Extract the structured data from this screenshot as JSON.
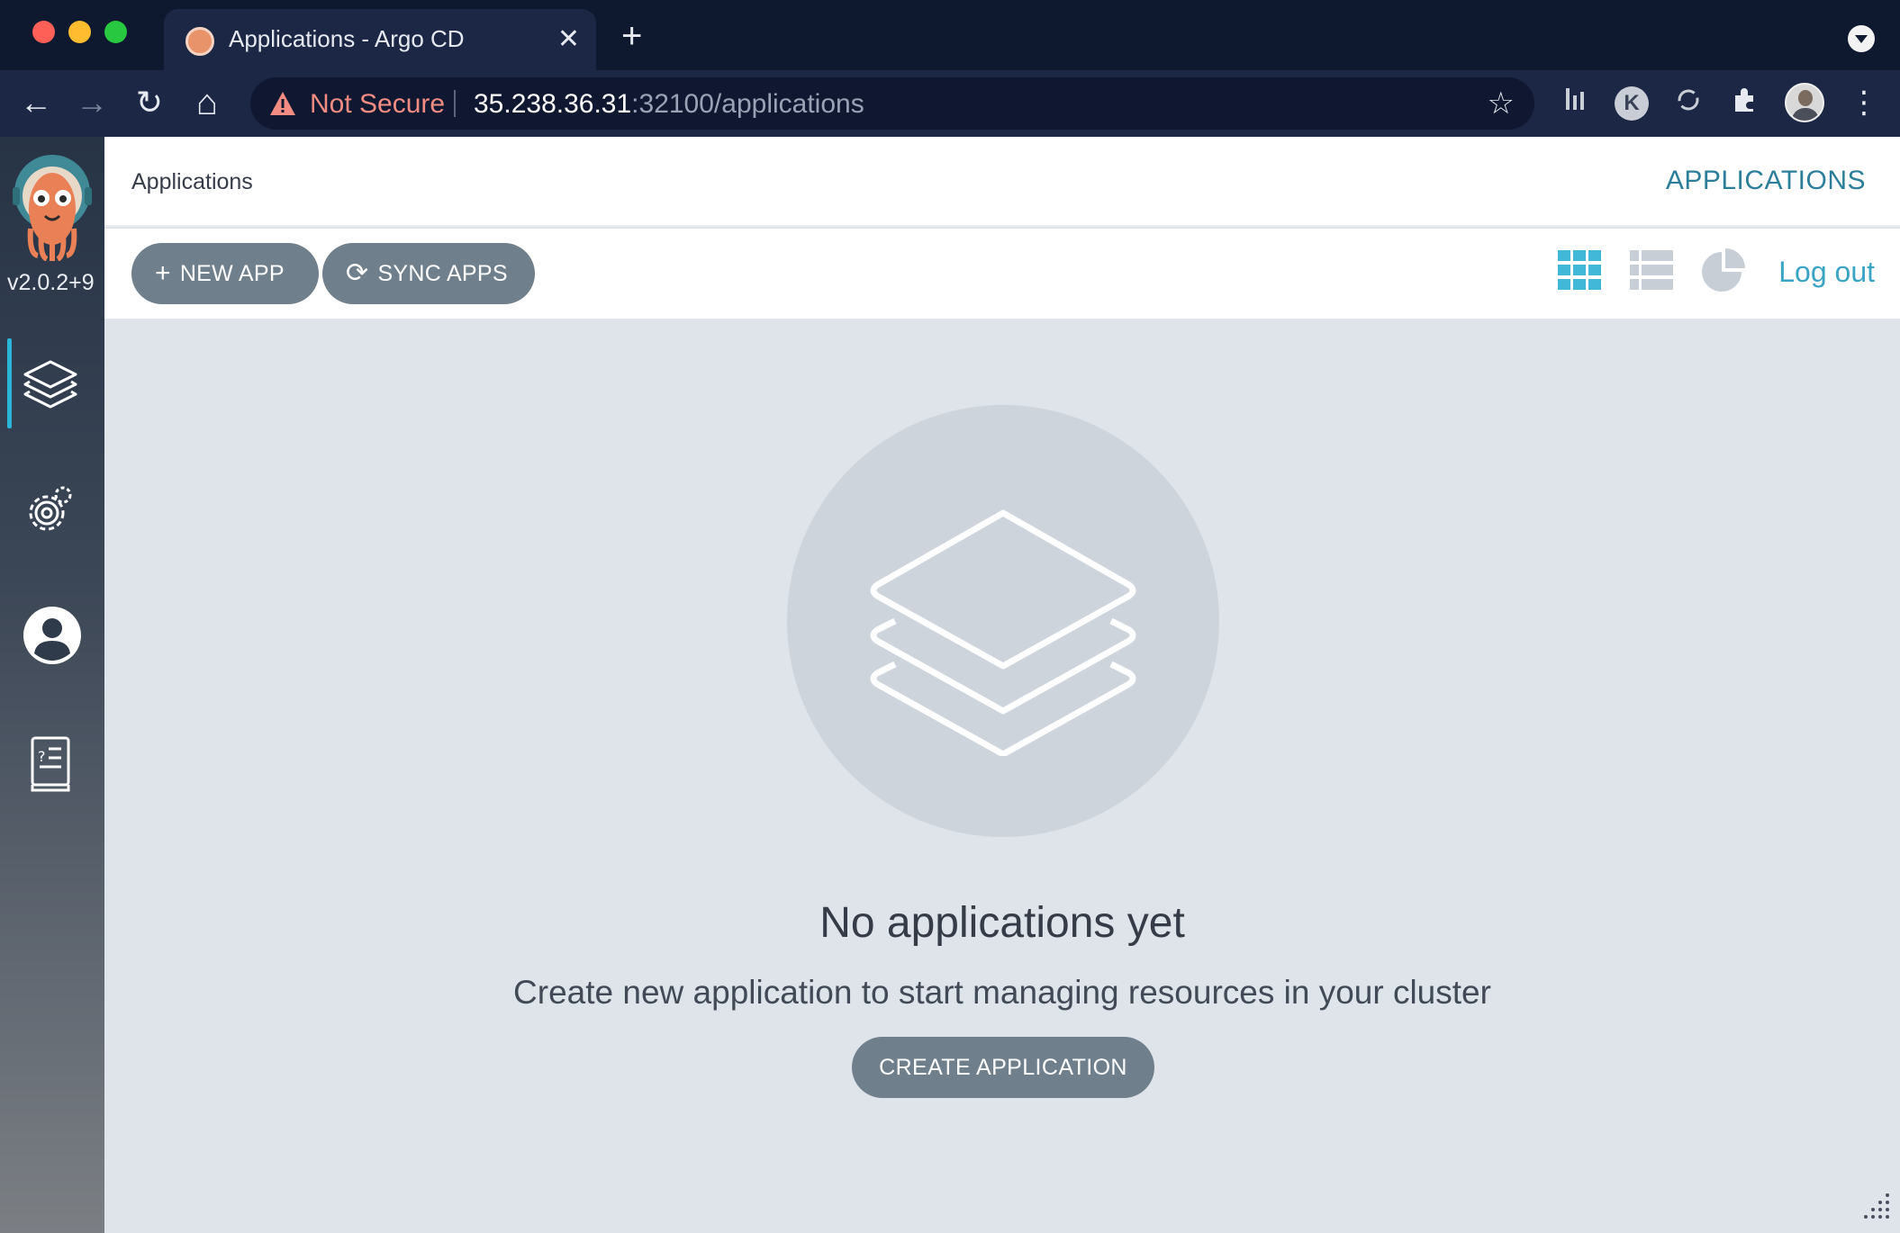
{
  "browser": {
    "tab_title": "Applications - Argo CD",
    "close_glyph": "✕",
    "new_tab_glyph": "+",
    "security_label": "Not Secure",
    "url_host": "35.238.36.31",
    "url_rest": ":32100/applications",
    "nav": {
      "back": "←",
      "forward": "→",
      "reload": "↻",
      "home": "⌂"
    },
    "bookmark_glyph": "☆",
    "extension_k": "K",
    "menu_glyph": "⋮"
  },
  "sidebar": {
    "version": "v2.0.2+9",
    "items": [
      {
        "name": "applications",
        "icon": "layers-icon",
        "active": true
      },
      {
        "name": "settings",
        "icon": "gear-icon",
        "active": false
      },
      {
        "name": "user-info",
        "icon": "user-circle-icon",
        "active": false
      },
      {
        "name": "documentation",
        "icon": "book-icon",
        "active": false
      }
    ]
  },
  "header": {
    "breadcrumb": "Applications",
    "title": "APPLICATIONS"
  },
  "actions": {
    "new_app": "NEW APP",
    "new_app_icon": "+",
    "sync_apps": "SYNC APPS",
    "sync_apps_icon": "⟳",
    "logout": "Log out",
    "views": [
      "tiles-view-icon",
      "list-view-icon",
      "pie-chart-view-icon"
    ]
  },
  "empty_state": {
    "title": "No applications yet",
    "subtitle": "Create new application to start managing resources in your cluster",
    "button": "CREATE APPLICATION"
  },
  "colors": {
    "accent": "#3aa4c4",
    "title_accent": "#2c7e9a",
    "button_bg": "#6f7f8c",
    "warning": "#f28b82",
    "active_tile_icon": "#41b8d8",
    "inactive_view_icon": "#c7ced6"
  }
}
